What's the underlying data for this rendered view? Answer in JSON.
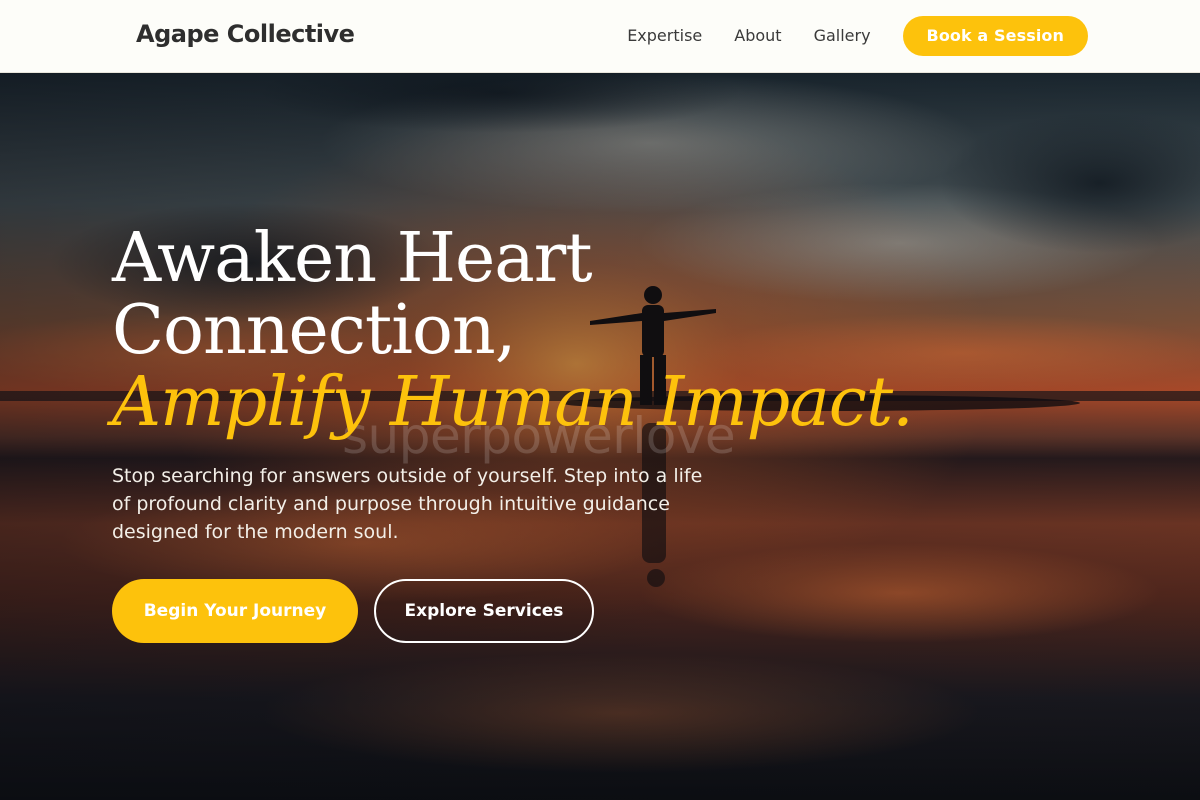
{
  "header": {
    "brand": "Agape Collective",
    "nav": [
      {
        "label": "Expertise"
      },
      {
        "label": "About"
      },
      {
        "label": "Gallery"
      }
    ],
    "cta_label": "Book a Session"
  },
  "hero": {
    "headline_line1": "Awaken Heart",
    "headline_line2": "Connection,",
    "headline_accent": "Amplify Human Impact.",
    "watermark": "superpowerlove",
    "lead": "Stop searching for answers outside of yourself. Step into a life of profound clarity and purpose through intuitive guidance designed for the modern soul.",
    "primary_cta": "Begin Your Journey",
    "secondary_cta": "Explore Services"
  },
  "colors": {
    "accent": "#fdc20c",
    "header_bg": "#fdfdf9",
    "text_dark": "#2e2e2e"
  }
}
